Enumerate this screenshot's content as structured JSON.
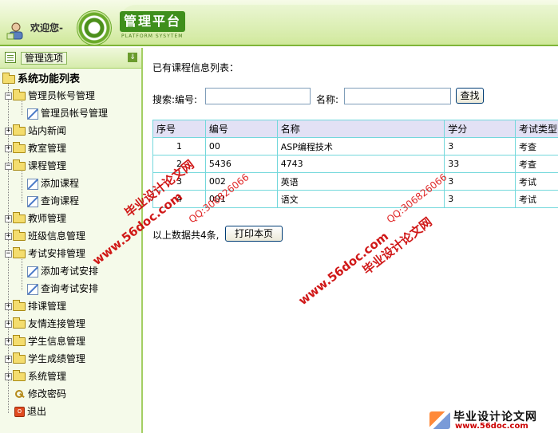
{
  "header": {
    "welcome": "欢迎您-",
    "logo_title": "管理平台",
    "logo_subtitle": "PLATFORM SYSYTEM"
  },
  "sidebar": {
    "title": "管理选项",
    "collapse_glyph": "⇓",
    "root": "系统功能列表",
    "items": [
      {
        "label": "管理员帐号管理",
        "state": "expanded",
        "children": [
          "管理员帐号管理"
        ]
      },
      {
        "label": "站内新闻",
        "state": "collapsed"
      },
      {
        "label": "教室管理",
        "state": "collapsed"
      },
      {
        "label": "课程管理",
        "state": "expanded",
        "children": [
          "添加课程",
          "查询课程"
        ]
      },
      {
        "label": "教师管理",
        "state": "collapsed"
      },
      {
        "label": "班级信息管理",
        "state": "collapsed"
      },
      {
        "label": "考试安排管理",
        "state": "expanded",
        "children": [
          "添加考试安排",
          "查询考试安排"
        ]
      },
      {
        "label": "排课管理",
        "state": "collapsed"
      },
      {
        "label": "友情连接管理",
        "state": "collapsed"
      },
      {
        "label": "学生信息管理",
        "state": "collapsed"
      },
      {
        "label": "学生成绩管理",
        "state": "collapsed"
      },
      {
        "label": "系统管理",
        "state": "collapsed"
      }
    ],
    "change_password": "修改密码",
    "logout": "退出"
  },
  "main": {
    "list_title": "已有课程信息列表：",
    "search": {
      "prefix_label": "搜索:编号:",
      "code_value": "",
      "name_label": "名称:",
      "name_value": "",
      "button": "查找"
    },
    "table": {
      "headers": [
        "序号",
        "编号",
        "名称",
        "学分",
        "考试类型"
      ],
      "rows": [
        [
          "1",
          "00",
          "ASP编程技术",
          "3",
          "考查"
        ],
        [
          "2",
          "5436",
          "4743",
          "33",
          "考查"
        ],
        [
          "3",
          "002",
          "英语",
          "3",
          "考试"
        ],
        [
          "4",
          "001",
          "语文",
          "3",
          "考试"
        ]
      ]
    },
    "summary": "以上数据共4条,",
    "print_button": "打印本页"
  },
  "watermarks": {
    "site": "www.56doc.com",
    "qq": "QQ:306826066",
    "cn": "毕业设计论文网"
  },
  "footer_logo": {
    "text": "毕业设计论文网",
    "url": "www.56doc.com"
  }
}
